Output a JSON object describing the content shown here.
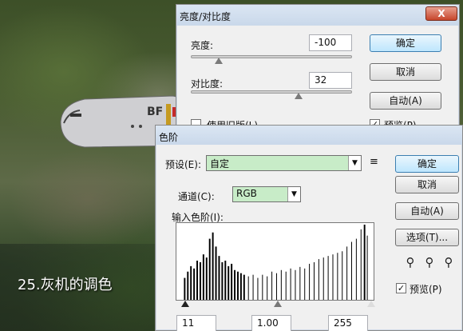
{
  "caption": "25.灰机的调色",
  "brightness_dialog": {
    "title": "亮度/对比度",
    "close": "X",
    "brightness_label": "亮度:",
    "brightness_value": "-100",
    "contrast_label": "对比度:",
    "contrast_value": "32",
    "ok": "确定",
    "cancel": "取消",
    "auto": "自动(A)",
    "legacy_label": "使用旧版(L)",
    "preview_label": "预览(P)"
  },
  "levels_dialog": {
    "title": "色阶",
    "preset_label": "预设(E):",
    "preset_value": "自定",
    "channel_label": "通道(C):",
    "channel_value": "RGB",
    "input_levels_label": "输入色阶(I):",
    "input_black": "11",
    "input_gamma": "1.00",
    "input_white": "255",
    "ok": "确定",
    "cancel": "取消",
    "auto": "自动(A)",
    "options": "选项(T)...",
    "preview_label": "预览(P)",
    "eyedroppers": [
      "black-eyedropper-icon",
      "gray-eyedropper-icon",
      "white-eyedropper-icon"
    ]
  },
  "colors": {
    "accent": "#3c7fb1",
    "select_bg": "#c8ecc8",
    "title_bg": "#c9d8ea"
  }
}
